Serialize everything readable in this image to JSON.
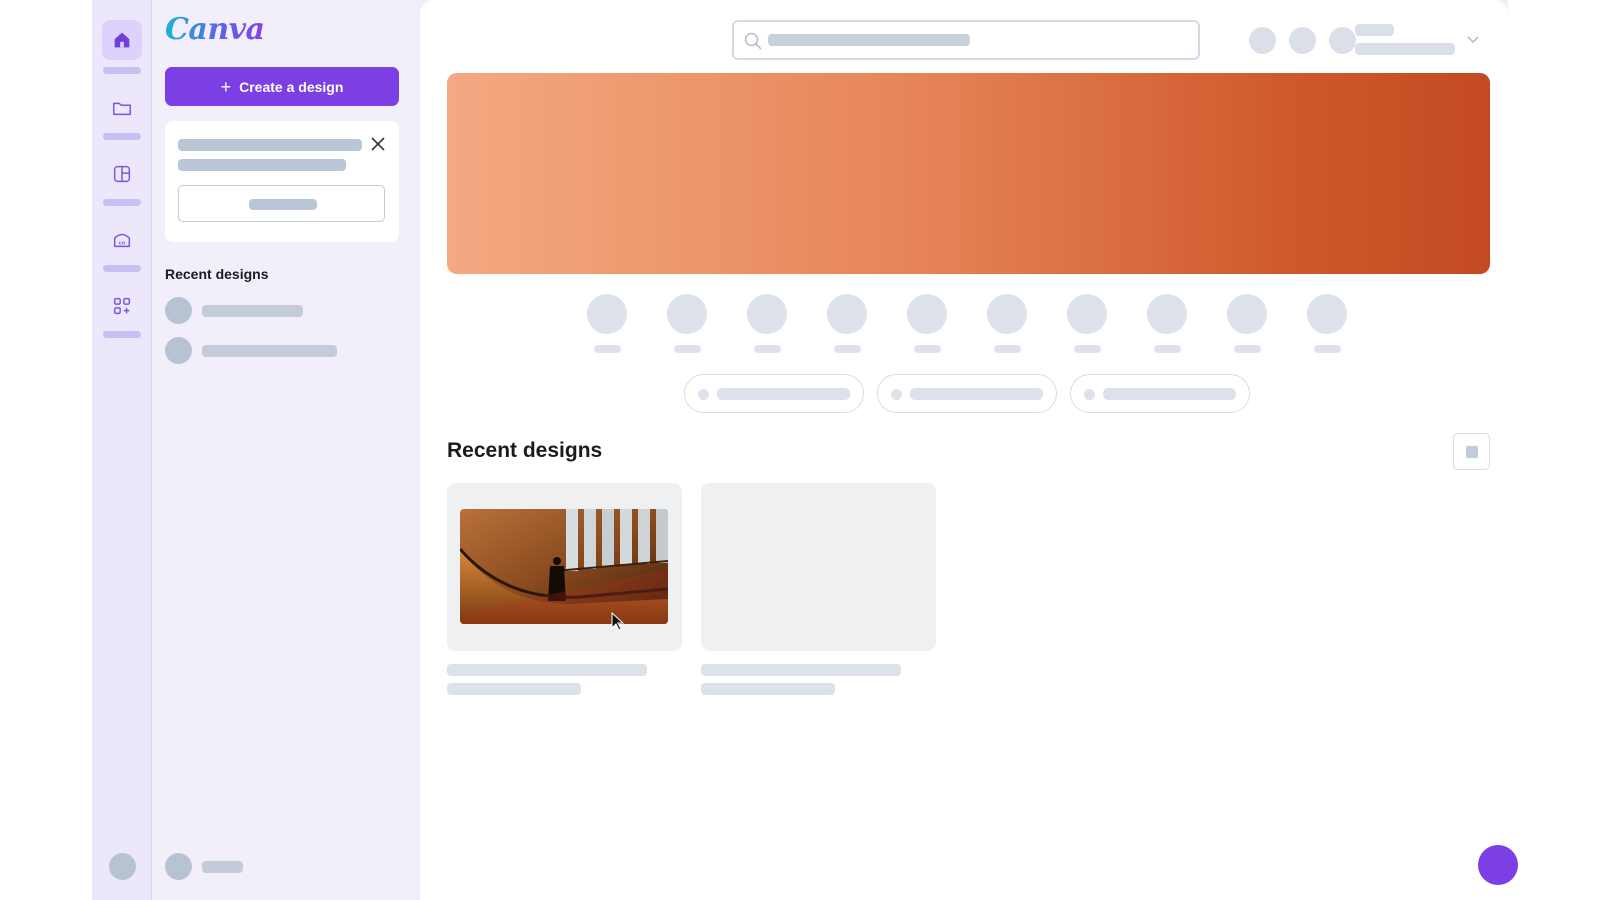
{
  "brand": {
    "logo_text": "Canva",
    "accent": "#7b3fe4"
  },
  "rail": {
    "items": [
      {
        "icon": "home-icon",
        "active": true
      },
      {
        "icon": "folder-icon",
        "active": false
      },
      {
        "icon": "templates-icon",
        "active": false
      },
      {
        "icon": "brand-icon",
        "active": false
      },
      {
        "icon": "apps-icon",
        "active": false
      }
    ]
  },
  "panel": {
    "create_label": "Create a design",
    "recent_title": "Recent designs"
  },
  "main": {
    "recent_title": "Recent designs",
    "banner_colors": [
      "#f4a982",
      "#c44a21"
    ]
  }
}
